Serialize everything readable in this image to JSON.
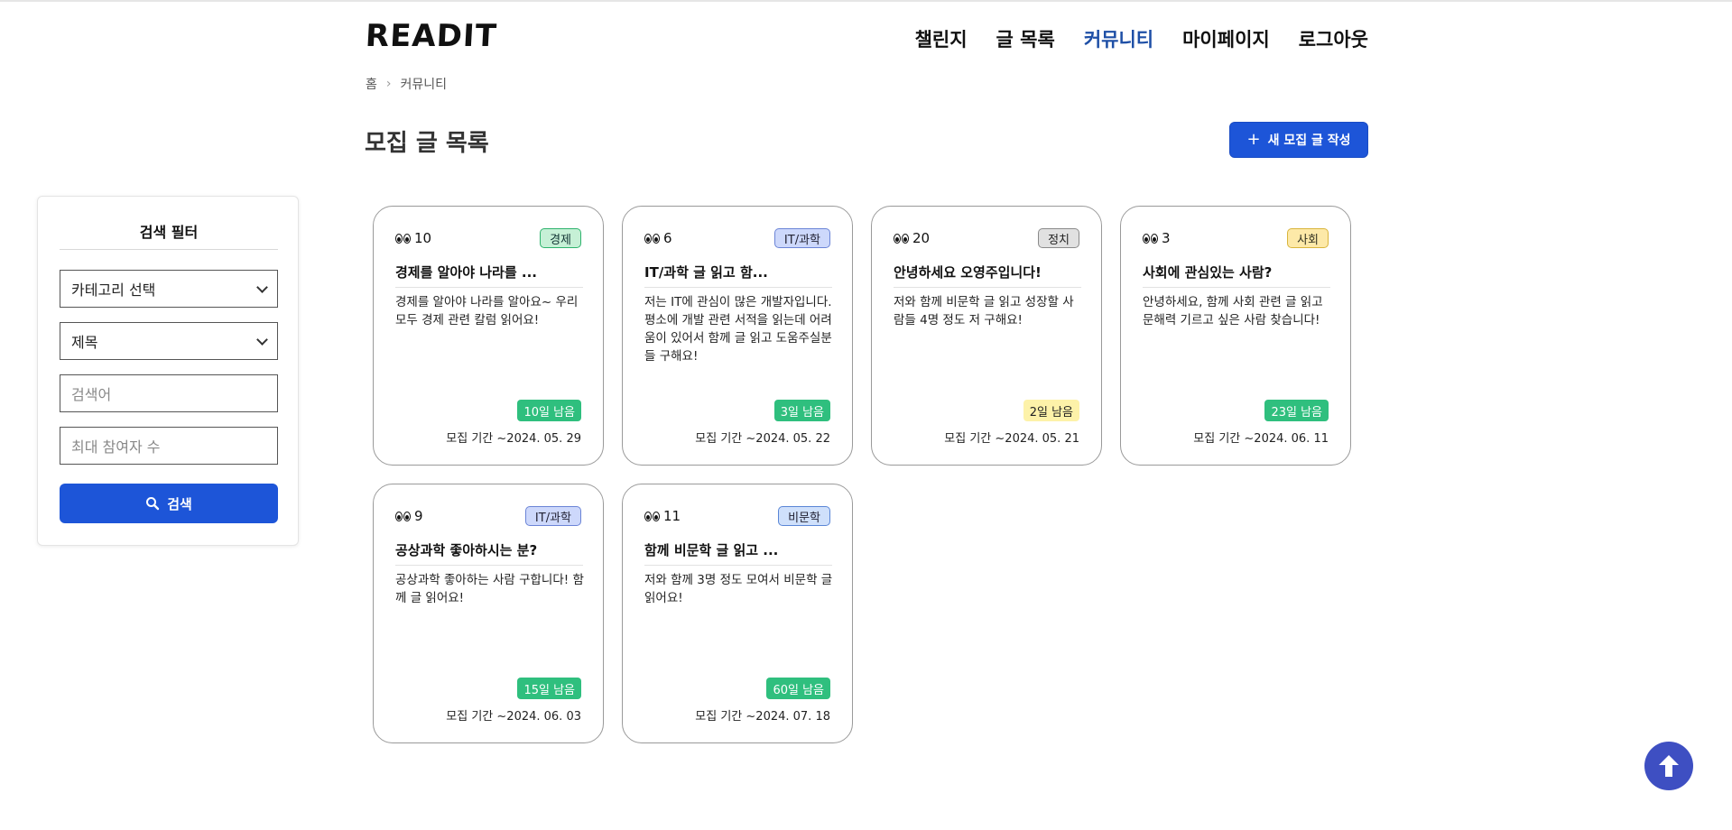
{
  "header": {
    "logo": "READIT",
    "nav": [
      "챌린지",
      "글 목록",
      "커뮤니티",
      "마이페이지",
      "로그아웃"
    ],
    "active_nav": "커뮤니티"
  },
  "breadcrumb": [
    "홈",
    "커뮤니티"
  ],
  "page_title": "모집 글 목록",
  "new_post_button": "새 모집 글 작성",
  "filter": {
    "title": "검색 필터",
    "category_select": "카테고리 선택",
    "field_select": "제목",
    "keyword_placeholder": "검색어",
    "max_participants_placeholder": "최대 참여자 수",
    "search_button": "검색"
  },
  "cards": [
    {
      "views": "10",
      "category": "경제",
      "title": "경제를 알아야 나라를 ...",
      "description": "경제를 알아야 나라를 알아요~ 우리 모두 경제 관련 칼럼 읽어요!",
      "remaining": "10일 남음",
      "period": "모집 기간 ~2024. 05. 29"
    },
    {
      "views": "6",
      "category": "IT/과학",
      "title": "IT/과학 글 읽고 함...",
      "description": "저는 IT에 관심이 많은 개발자입니다. 평소에 개발 관련 서적을 읽는데 어려움이 있어서 함께 글 읽고 도움주실분들 구해요!",
      "remaining": "3일 남음",
      "period": "모집 기간 ~2024. 05. 22"
    },
    {
      "views": "20",
      "category": "정치",
      "title": "안녕하세요 오영주입니다!",
      "description": "저와 함께 비문학 글 읽고 성장할 사람들 4명 정도 저 구해요!",
      "remaining": "2일 남음",
      "period": "모집 기간 ~2024. 05. 21"
    },
    {
      "views": "3",
      "category": "사회",
      "title": "사회에 관심있는 사람?",
      "description": "안녕하세요, 함께 사회 관련 글 읽고 문해력 기르고 싶은 사람 찾습니다!",
      "remaining": "23일 남음",
      "period": "모집 기간 ~2024. 06. 11"
    },
    {
      "views": "9",
      "category": "IT/과학",
      "title": "공상과학 좋아하시는 분?",
      "description": "공상과학 좋아하는 사람 구합니다! 함께 글 읽어요!",
      "remaining": "15일 남음",
      "period": "모집 기간 ~2024. 06. 03"
    },
    {
      "views": "11",
      "category": "비문학",
      "title": "함께 비문학 글 읽고 ...",
      "description": "저와 함께 3명 정도 모여서 비문학 글 읽어요!",
      "remaining": "60일 남음",
      "period": "모집 기간 ~2024. 07. 18"
    }
  ],
  "colors": {
    "accent_blue": "#1d55d8",
    "active_nav": "#1e4fa6",
    "remaining_green": "#2fbf7e",
    "remaining_yellow": "#fdf2a9",
    "scroll_top": "#3e4fc2"
  }
}
